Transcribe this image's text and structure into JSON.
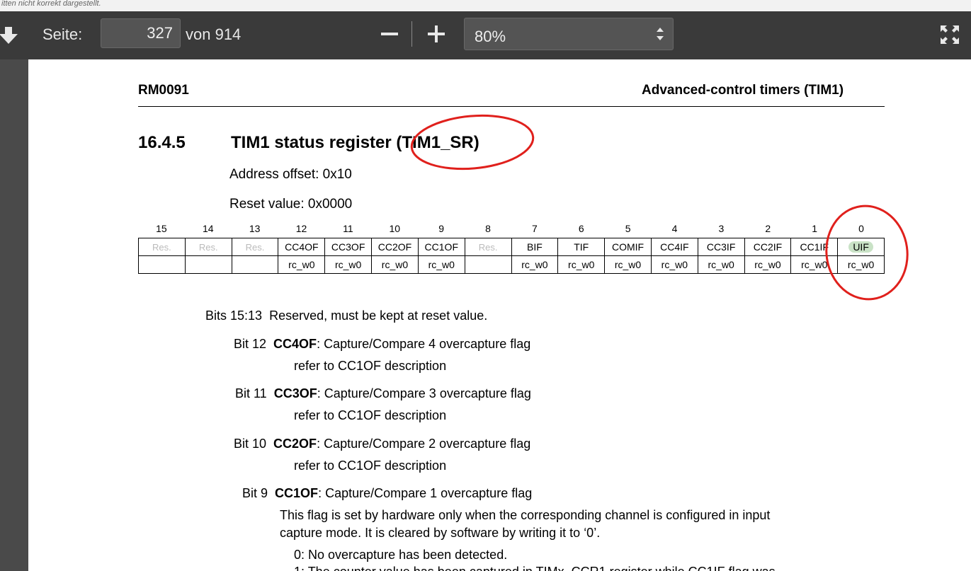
{
  "notice": "itten nicht korrekt dargestellt.",
  "toolbar": {
    "page_label": "Seite:",
    "page_value": "327",
    "page_total": "von 914",
    "zoom_value": "80%"
  },
  "doc": {
    "header_left": "RM0091",
    "header_right": "Advanced-control timers (TIM1)",
    "section_number": "16.4.5",
    "section_title": "TIM1 status register (TIM1_SR)",
    "address_offset": "Address offset: 0x10",
    "reset_value": "Reset value: 0x0000",
    "bit_numbers": [
      "15",
      "14",
      "13",
      "12",
      "11",
      "10",
      "9",
      "8",
      "7",
      "6",
      "5",
      "4",
      "3",
      "2",
      "1",
      "0"
    ],
    "bit_names": [
      "Res.",
      "Res.",
      "Res.",
      "CC4OF",
      "CC3OF",
      "CC2OF",
      "CC1OF",
      "Res.",
      "BIF",
      "TIF",
      "COMIF",
      "CC4IF",
      "CC3IF",
      "CC2IF",
      "CC1IF",
      "UIF"
    ],
    "access": [
      "",
      "",
      "",
      "rc_w0",
      "rc_w0",
      "rc_w0",
      "rc_w0",
      "",
      "rc_w0",
      "rc_w0",
      "rc_w0",
      "rc_w0",
      "rc_w0",
      "rc_w0",
      "rc_w0",
      "rc_w0"
    ],
    "bits_15_13": {
      "label": "Bits 15:13",
      "text": "Reserved, must be kept at reset value."
    },
    "bit12": {
      "label": "Bit 12",
      "name": "CC4OF",
      "text": ": Capture/Compare 4 overcapture flag",
      "ref": "refer to CC1OF description"
    },
    "bit11": {
      "label": "Bit 11",
      "name": "CC3OF",
      "text": ": Capture/Compare 3 overcapture flag",
      "ref": "refer to CC1OF description"
    },
    "bit10": {
      "label": "Bit 10",
      "name": "CC2OF",
      "text": ": Capture/Compare 2 overcapture flag",
      "ref": "refer to CC1OF description"
    },
    "bit9": {
      "label": "Bit 9",
      "name": "CC1OF",
      "text": ": Capture/Compare 1 overcapture flag",
      "para1": "This flag is set by hardware only when the corresponding channel is configured in input",
      "para2": "capture mode. It is cleared by software by writing it to ‘0’.",
      "opt0": "0: No overcapture has been detected.",
      "opt1": "1: The counter value has been captured in TIMx_CCR1 register while CC1IF flag was"
    }
  },
  "colors": {
    "annotation": "#e0201c",
    "uif_highlight": "#c9e2c6",
    "toolbar_bg": "#3a3a3a"
  }
}
